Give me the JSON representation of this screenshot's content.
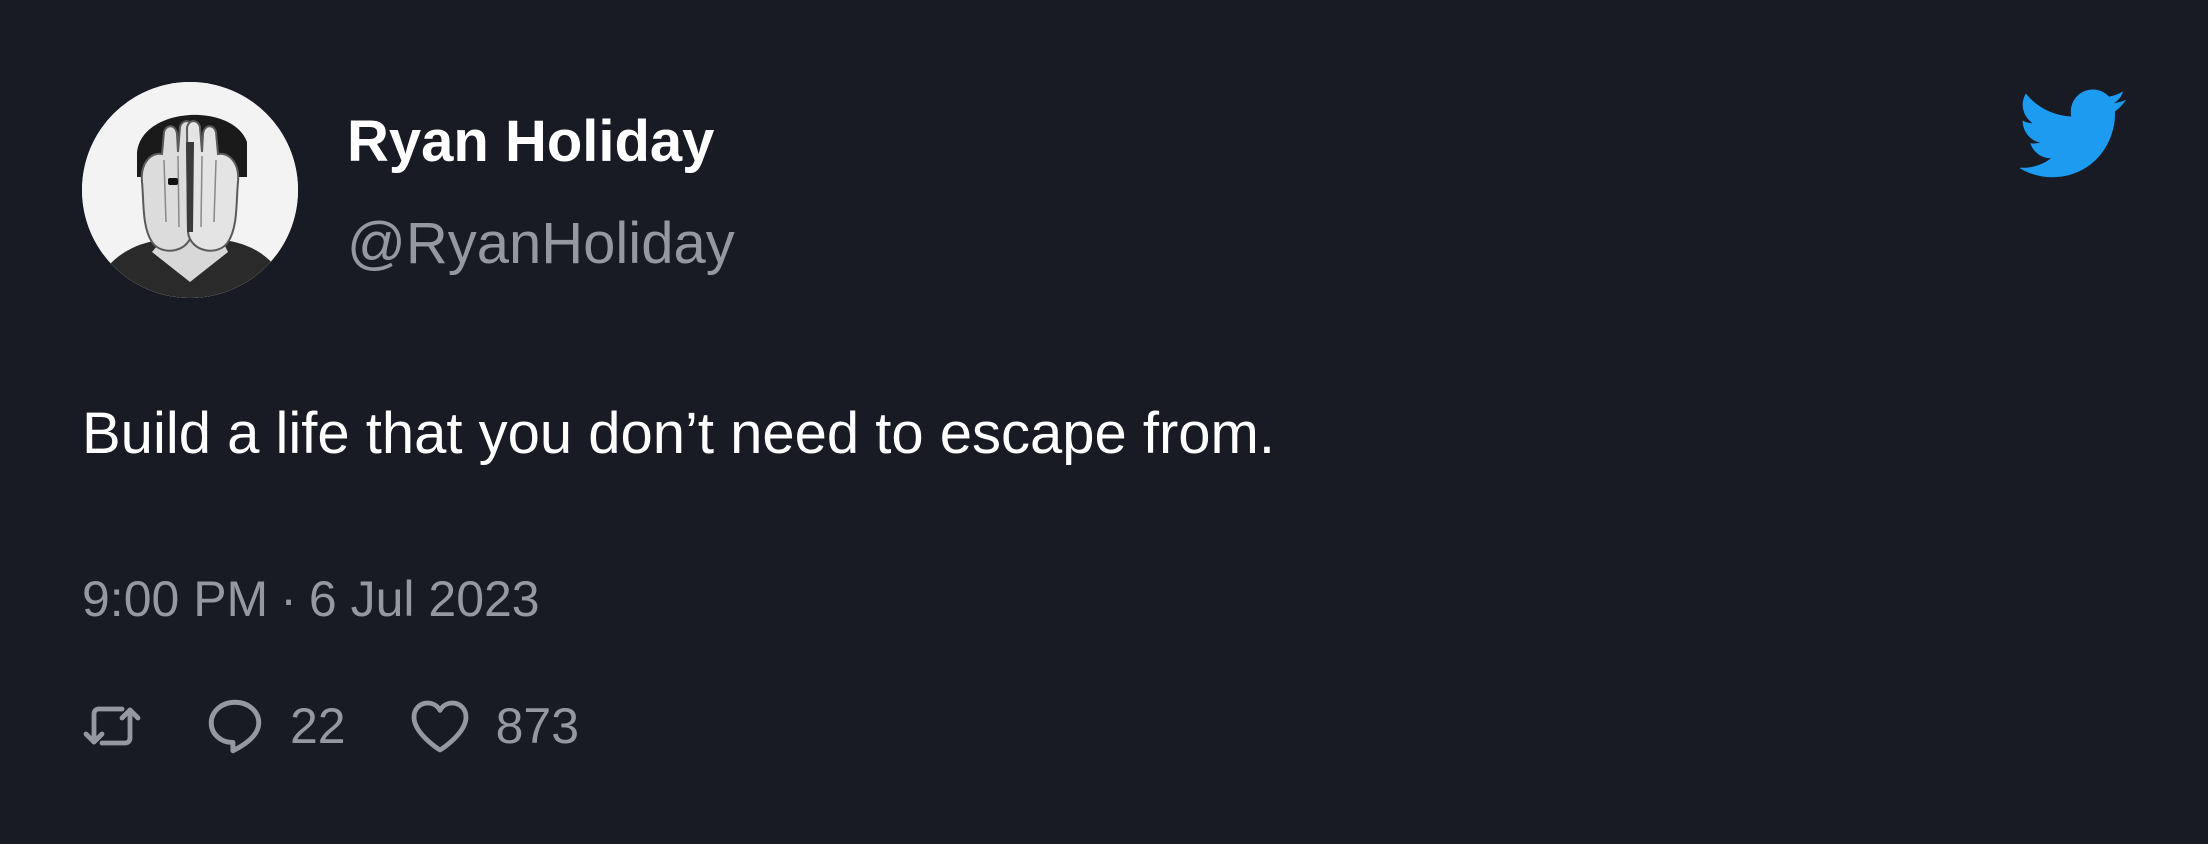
{
  "author": {
    "name": "Ryan Holiday",
    "handle": "@RyanHoliday"
  },
  "tweet": {
    "text": "Build a life that you don’t need to escape from.",
    "time": "9:00 PM",
    "separator": "·",
    "date": "6 Jul 2023"
  },
  "actions": {
    "retweet_icon": "retweet-icon",
    "reply_icon": "reply-icon",
    "reply_count": "22",
    "like_icon": "heart-icon",
    "like_count": "873"
  },
  "colors": {
    "background": "#191b24",
    "text_primary": "#ffffff",
    "text_secondary": "#9597a1",
    "twitter_blue": "#1d9bf0"
  }
}
